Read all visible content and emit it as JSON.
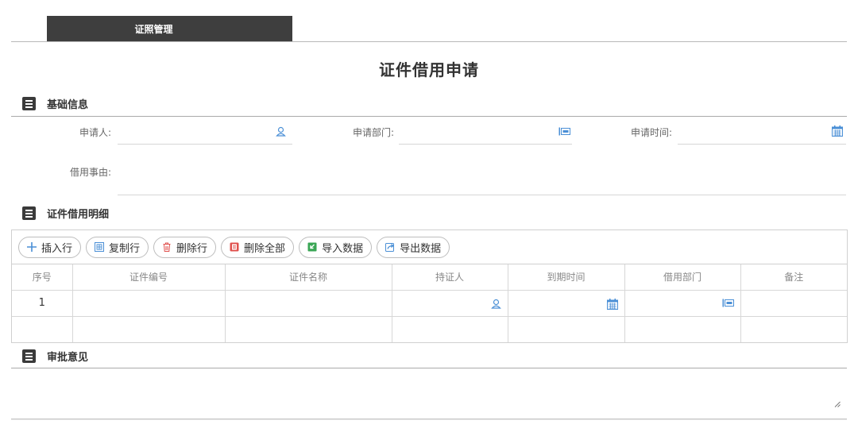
{
  "top_tab": {
    "label": "证照管理"
  },
  "page_title": "证件借用申请",
  "sections": {
    "basic": {
      "title": "基础信息"
    },
    "detail": {
      "title": "证件借用明细"
    },
    "approval": {
      "title": "审批意见"
    }
  },
  "basic_fields": {
    "applicant": {
      "label": "申请人:",
      "value": ""
    },
    "department": {
      "label": "申请部门:",
      "value": ""
    },
    "apply_time": {
      "label": "申请时间:",
      "value": ""
    },
    "reason": {
      "label": "借用事由:",
      "value": ""
    }
  },
  "toolbar": {
    "insert_row": "插入行",
    "copy_row": "复制行",
    "delete_row": "删除行",
    "delete_all": "删除全部",
    "import_data": "导入数据",
    "export_data": "导出数据"
  },
  "table": {
    "columns": [
      "序号",
      "证件编号",
      "证件名称",
      "持证人",
      "到期时间",
      "借用部门",
      "备注"
    ],
    "rows": [
      {
        "seq": "1",
        "cert_no": "",
        "cert_name": "",
        "holder": "",
        "expire": "",
        "dept": "",
        "note": ""
      },
      {
        "seq": "",
        "cert_no": "",
        "cert_name": "",
        "holder": "",
        "expire": "",
        "dept": "",
        "note": ""
      }
    ]
  },
  "approval": {
    "value": ""
  },
  "colors": {
    "accent": "#4a8fd6",
    "danger": "#e0504d",
    "success": "#3aa655",
    "tab_bg": "#3e3e3e"
  },
  "icons": [
    "user-icon",
    "department-icon",
    "calendar-icon",
    "plus-icon",
    "copy-icon",
    "trash-icon",
    "delete-all-icon",
    "import-icon",
    "export-icon",
    "resize-handle-icon"
  ]
}
